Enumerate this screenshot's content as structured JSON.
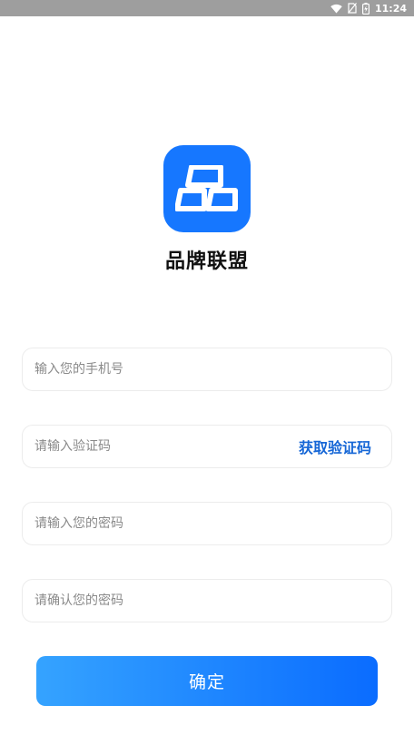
{
  "status_bar": {
    "time": "11:24",
    "icons": [
      "wifi-icon",
      "no-sim-icon",
      "battery-charging-icon"
    ]
  },
  "app": {
    "name": "品牌联盟",
    "logo_color": "#1677ff",
    "logo_icon": "pin-brand-logo-icon"
  },
  "form": {
    "phone": {
      "placeholder": "输入您的手机号",
      "value": ""
    },
    "code": {
      "placeholder": "请输入验证码",
      "value": "",
      "get_code_label": "获取验证码"
    },
    "password": {
      "placeholder": "请输入您的密码",
      "value": ""
    },
    "confirm_password": {
      "placeholder": "请确认您的密码",
      "value": ""
    },
    "submit_label": "确定"
  },
  "colors": {
    "accent": "#1566d6",
    "button_gradient_start": "#35a3ff",
    "button_gradient_end": "#0a6cff",
    "status_bar": "#9e9e9e"
  }
}
